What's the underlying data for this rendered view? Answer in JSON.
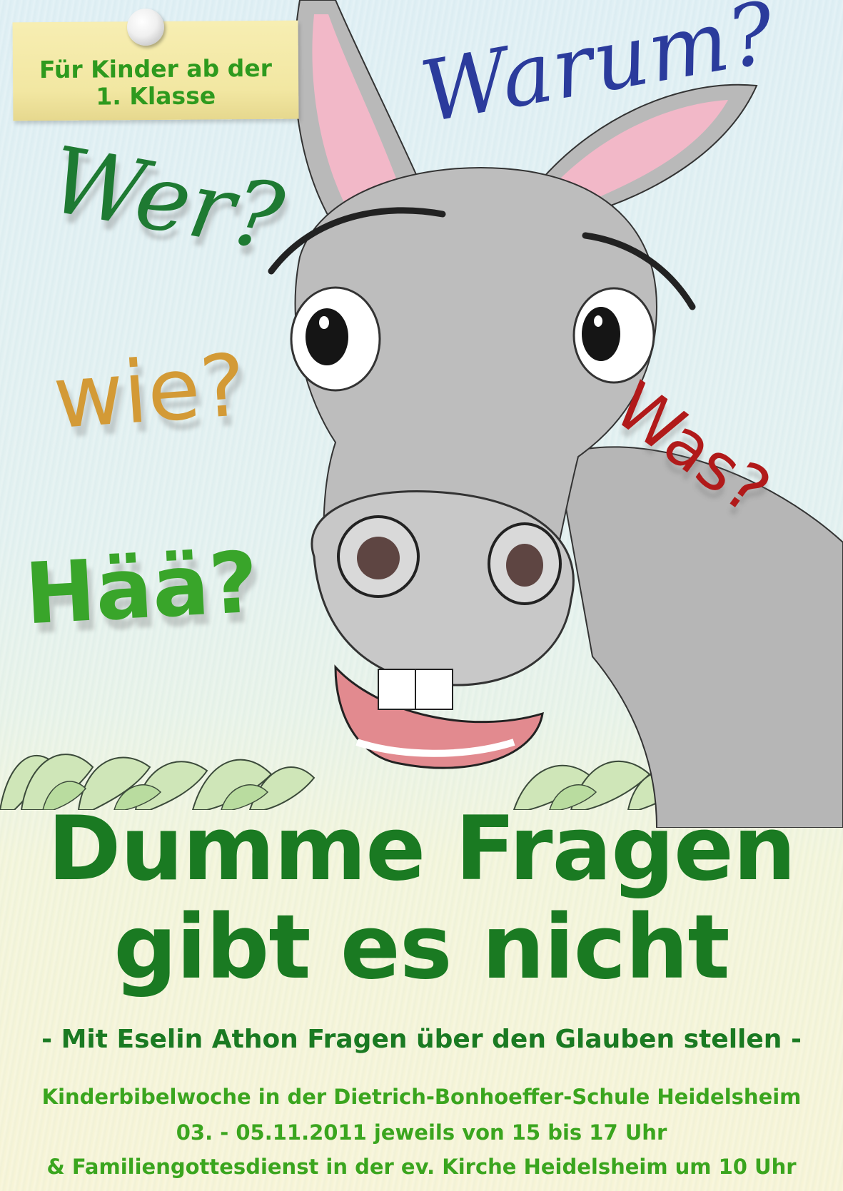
{
  "note": {
    "text": "Für Kinder ab der\n1. Klasse"
  },
  "words": {
    "warum": "Warum?",
    "wer": "Wer?",
    "wie": "wie?",
    "was": "Was?",
    "haa": "Hää?"
  },
  "title": {
    "line1": "Dumme Fragen",
    "line2": "gibt es nicht"
  },
  "subtitle": "- Mit Eselin Athon Fragen über den Glauben stellen -",
  "info": {
    "line1": "Kinderbibelwoche in der Dietrich-Bonhoeffer-Schule Heidelsheim",
    "line2": "03. - 05.11.2011 jeweils von 15 bis 17 Uhr",
    "line3": "& Familiengottesdienst in der ev. Kirche Heidelsheim um 10 Uhr"
  },
  "colors": {
    "title_green": "#1a7a22",
    "info_green": "#3aa51e",
    "warum_blue": "#2b3b9c",
    "wer_green": "#1e7a32",
    "wie_gold": "#d39a36",
    "was_red": "#b11a1a",
    "haa_green": "#39a52a"
  }
}
